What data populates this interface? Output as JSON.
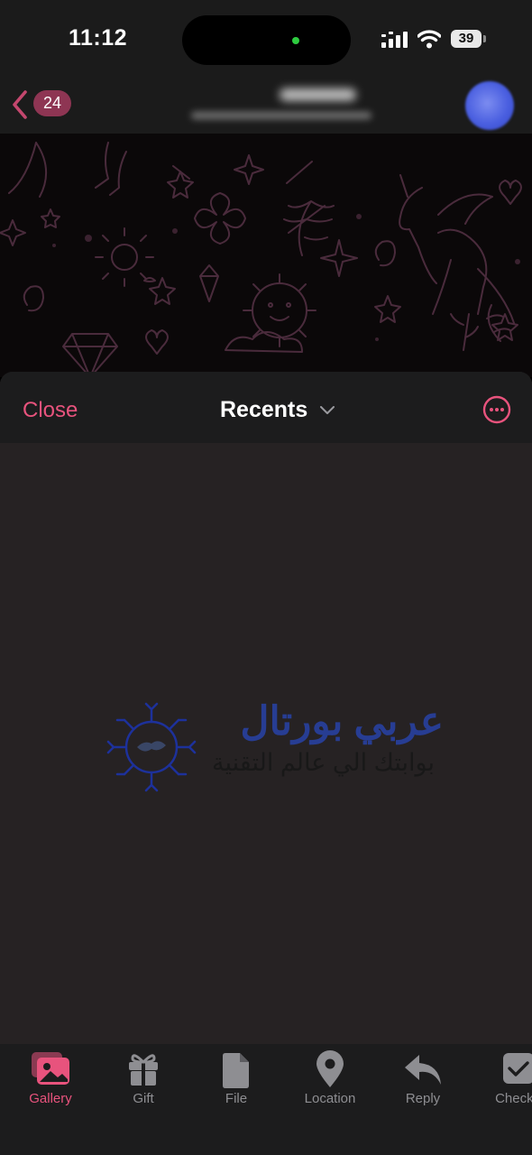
{
  "status_bar": {
    "time": "11:12",
    "battery": "39"
  },
  "header": {
    "unread_count": "24"
  },
  "sheet": {
    "close_label": "Close",
    "album_title": "Recents",
    "watermark_line1": "عربي بورتال",
    "watermark_line2": "بوابتك الي عالم التقنية"
  },
  "tabs": [
    {
      "label": "Gallery",
      "icon": "gallery-icon",
      "active": true
    },
    {
      "label": "Gift",
      "icon": "gift-icon",
      "active": false
    },
    {
      "label": "File",
      "icon": "file-icon",
      "active": false
    },
    {
      "label": "Location",
      "icon": "location-pin-icon",
      "active": false
    },
    {
      "label": "Reply",
      "icon": "reply-icon",
      "active": false
    },
    {
      "label": "Checkl",
      "icon": "checklist-icon",
      "active": false
    }
  ],
  "colors": {
    "accent": "#e8537d",
    "sheet_bg": "#262223",
    "bar_bg": "#1c1c1d",
    "badge_bg": "#8e3553"
  }
}
